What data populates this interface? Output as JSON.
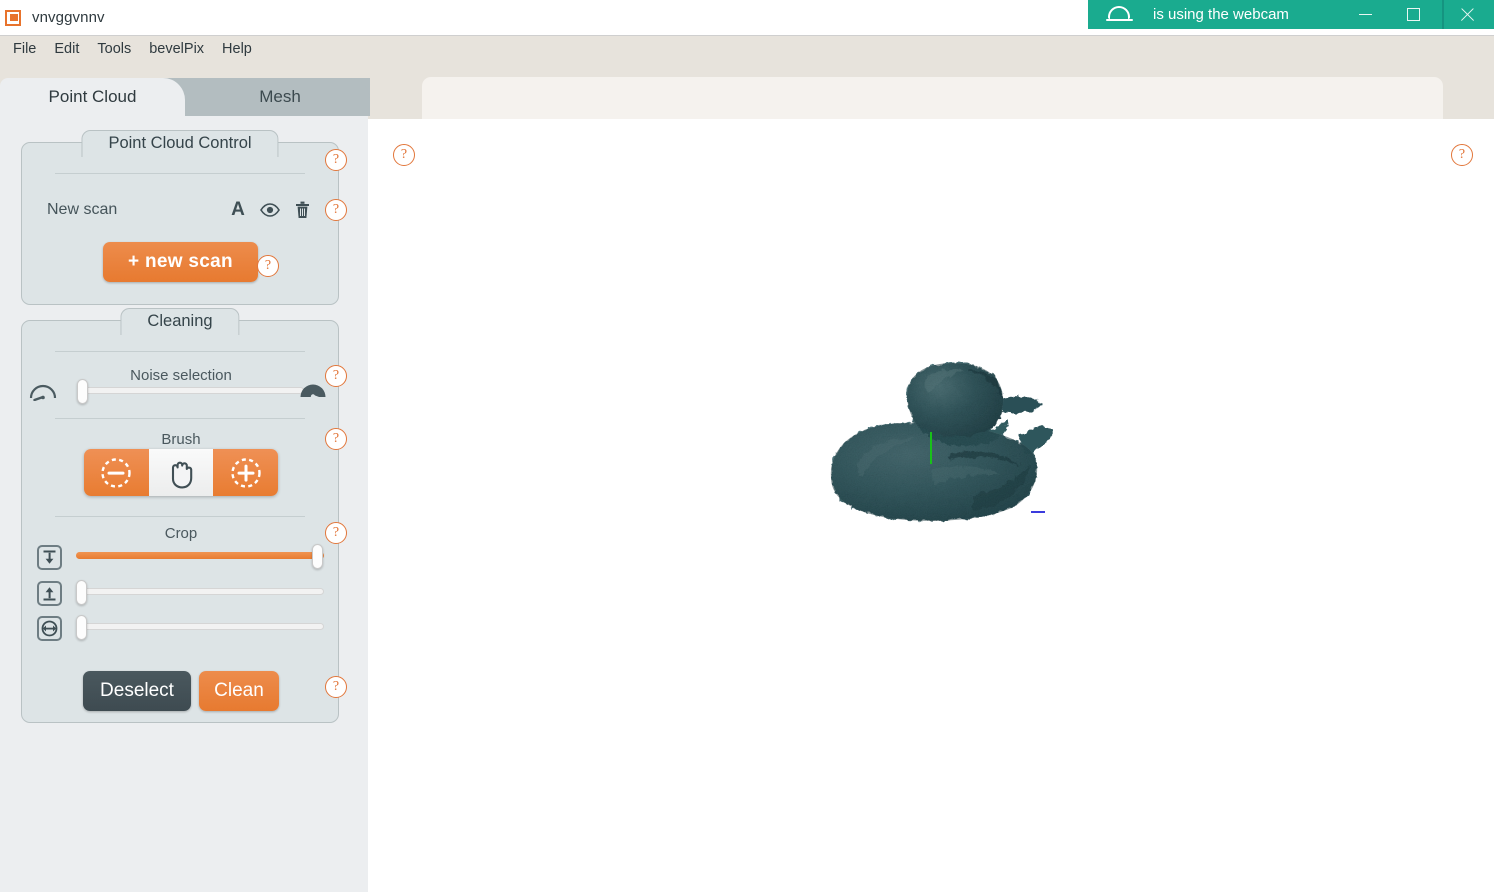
{
  "window": {
    "app_icon": "app-logo-icon",
    "title": "vnvggvnnv",
    "minimize_label": "–",
    "maximize_label": "□",
    "close_label": "×"
  },
  "notification": {
    "icon": "webcam-icon",
    "text": "is using the webcam",
    "background_color": "#1aab8f"
  },
  "menubar": {
    "items": [
      {
        "label": "File"
      },
      {
        "label": "Edit"
      },
      {
        "label": "Tools"
      },
      {
        "label": "bevelPix"
      },
      {
        "label": "Help"
      }
    ]
  },
  "tabs": [
    {
      "label": "Point Cloud",
      "active": true
    },
    {
      "label": "Mesh",
      "active": false
    }
  ],
  "help_badge_label": "?",
  "panels": {
    "point_cloud_control": {
      "title": "Point Cloud Control",
      "scan": {
        "name": "New scan",
        "rename_icon": "letter-a-rename-icon",
        "visibility_icon": "eye-icon",
        "delete_icon": "trash-icon"
      },
      "new_scan_button": "+ new scan"
    },
    "cleaning": {
      "title": "Cleaning",
      "noise_selection": {
        "label": "Noise selection",
        "value": 0,
        "min": 0,
        "max": 100,
        "left_icon": "gauge-low-icon",
        "right_icon": "gauge-high-icon"
      },
      "brush": {
        "label": "Brush",
        "buttons": [
          {
            "name": "brush-subtract",
            "icon": "circle-dashed-minus-icon",
            "selected": false
          },
          {
            "name": "brush-pan",
            "icon": "hand-icon",
            "selected": true
          },
          {
            "name": "brush-add",
            "icon": "circle-dashed-plus-icon",
            "selected": false
          }
        ]
      },
      "crop": {
        "label": "Crop",
        "sliders": [
          {
            "name": "crop-top",
            "icon": "arrow-down-to-line-icon",
            "value": 100
          },
          {
            "name": "crop-bottom",
            "icon": "arrow-up-from-line-icon",
            "value": 0
          },
          {
            "name": "crop-depth",
            "icon": "expand-horizontal-icon",
            "value": 0
          }
        ]
      },
      "deselect_button": "Deselect",
      "clean_button": "Clean"
    }
  },
  "viewport": {
    "model_name": "duck-point-cloud",
    "axis_y_color": "#19c119",
    "axis_z_color": "#3b3bdd",
    "point_cloud_color": "#3c6168"
  },
  "colors": {
    "accent_orange": "#e87c31",
    "panel_blue_gray": "#dde4e6",
    "sidebar_gray": "#eceef0",
    "chrome_beige": "#e7e3dc",
    "dark_button": "#434f55"
  }
}
